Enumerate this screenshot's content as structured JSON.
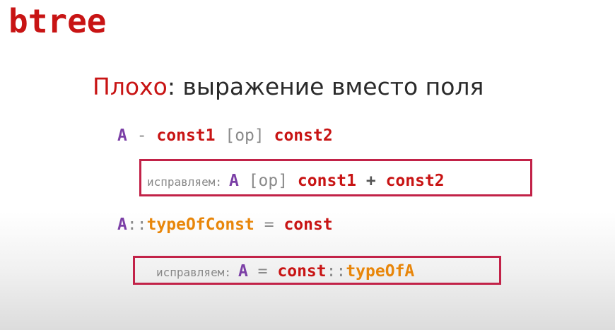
{
  "slide": {
    "title": "btree"
  },
  "heading": {
    "bad": "Плохо",
    "rest": ": выражение вместо поля"
  },
  "example1": {
    "var": "A",
    "op_minus": " - ",
    "const1": "const1",
    "op_placeholder": " [op] ",
    "const2": "const2"
  },
  "fix1": {
    "label": "исправляем:",
    "var": "A",
    "op_placeholder": " [op] ",
    "const1": "const1",
    "op_plus": " + ",
    "const2": "const2"
  },
  "example2": {
    "var": "A",
    "scope": "::",
    "type": "typeOfConst",
    "op_eq": " = ",
    "const": "const"
  },
  "fix2": {
    "label": "исправляем:",
    "var": "A",
    "op_eq": " = ",
    "const": "const",
    "scope": "::",
    "type": "typeOfA"
  },
  "colors": {
    "title_red": "#c81414",
    "box_border": "#c22248",
    "variable_purple": "#7b3fa6",
    "type_orange": "#e8860a",
    "label_gray": "#888888"
  }
}
